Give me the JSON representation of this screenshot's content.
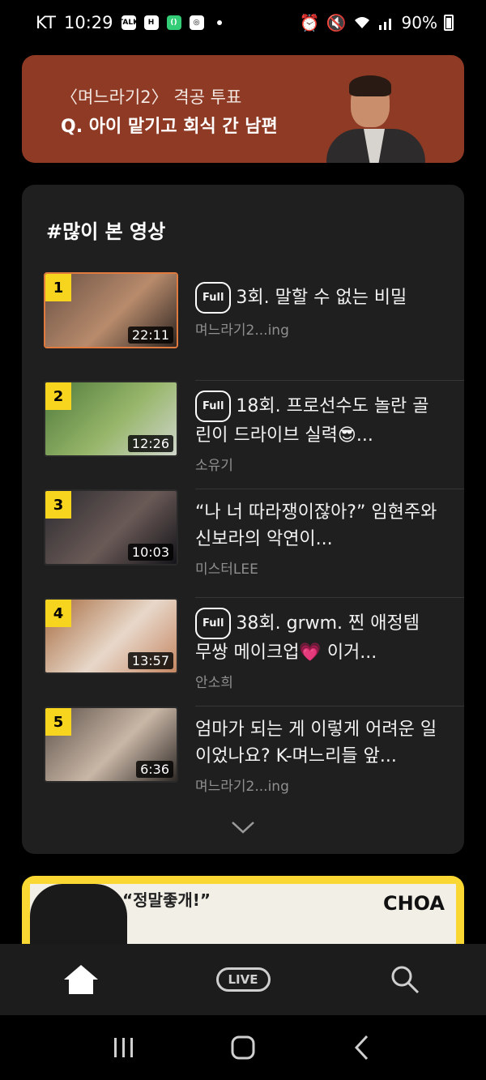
{
  "status_bar": {
    "carrier": "KT",
    "time": "10:29",
    "notif_icons": [
      "talk-icon",
      "h-icon",
      "app-icon",
      "record-icon"
    ],
    "battery": "90%"
  },
  "banner": {
    "subtitle": "〈며느라기2〉 격공 투표",
    "headline": "Q. 아이 맡기고 회식 간 남편"
  },
  "popular": {
    "section_title": "#많이 본 영상",
    "full_label": "Full",
    "items": [
      {
        "rank": "1",
        "duration": "22:11",
        "full": true,
        "title": "3회. 말할 수 없는 비밀",
        "channel": "며느라기2...ing",
        "colors": [
          "#6a5144",
          "#b88b6c",
          "#2e2521"
        ]
      },
      {
        "rank": "2",
        "duration": "12:26",
        "full": true,
        "title": "18회. 프로선수도 놀란 골린이 드라이브 실력😎...",
        "channel": "소유기",
        "colors": [
          "#4f7a3b",
          "#97b66a",
          "#cfd5cb"
        ]
      },
      {
        "rank": "3",
        "duration": "10:03",
        "full": false,
        "title": "“나 너 따라쟁이잖아?” 임현주와 신보라의 악연이...",
        "channel": "미스터LEE",
        "colors": [
          "#2b2b30",
          "#6a5a56",
          "#14141a"
        ]
      },
      {
        "rank": "4",
        "duration": "13:57",
        "full": true,
        "title": "38회. grwm. 찐 애정템 무쌍 메이크업💗 이거...",
        "channel": "안소희",
        "colors": [
          "#a66a3e",
          "#e8d8ca",
          "#c48662"
        ]
      },
      {
        "rank": "5",
        "duration": "6:36",
        "full": false,
        "title": "엄마가 되는 게 이렇게 어려운 일이었나요? K-며느리들 앞...",
        "channel": "며느라기2...ing",
        "colors": [
          "#5e524a",
          "#c9b7a6",
          "#2f2a27"
        ]
      }
    ]
  },
  "ad": {
    "speech": "“정말좋개!”",
    "brand": "CHOA"
  },
  "bottom_nav": {
    "items": [
      {
        "name": "home",
        "label": ""
      },
      {
        "name": "live",
        "label": "LIVE"
      },
      {
        "name": "search",
        "label": ""
      }
    ]
  }
}
